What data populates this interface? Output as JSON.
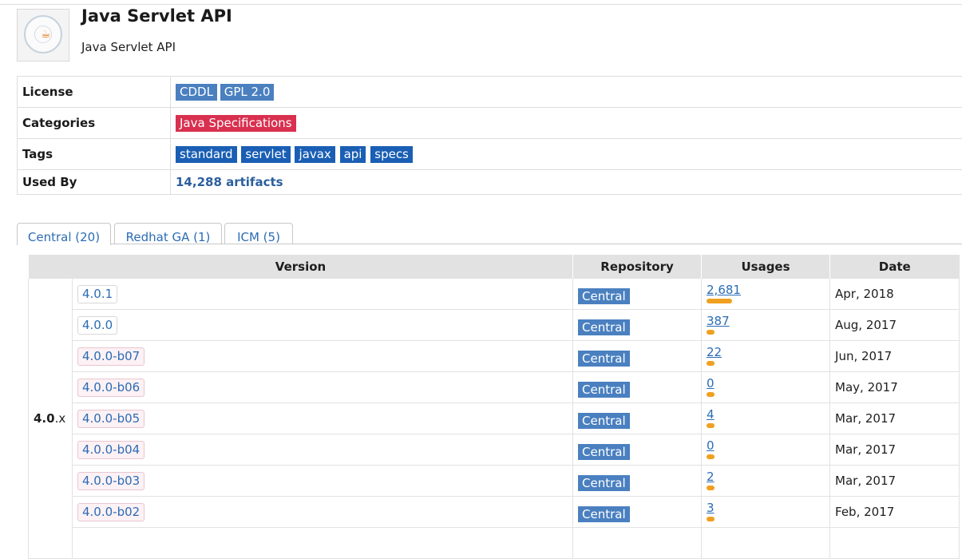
{
  "artifact": {
    "title": "Java Servlet API",
    "description": "Java Servlet API",
    "logo_alt": "Java Community Process seal"
  },
  "info": {
    "license": {
      "key": "License",
      "labels": [
        "CDDL",
        "GPL 2.0"
      ]
    },
    "categories": {
      "key": "Categories",
      "labels": [
        "Java Specifications"
      ]
    },
    "tags": {
      "key": "Tags",
      "labels": [
        "standard",
        "servlet",
        "javax",
        "api",
        "specs"
      ]
    },
    "used_by": {
      "key": "Used By",
      "value": "14,288 artifacts"
    }
  },
  "tabs": [
    {
      "label": "Central (20)",
      "active": true
    },
    {
      "label": "Redhat GA (1)",
      "active": false
    },
    {
      "label": "ICM (5)",
      "active": false
    }
  ],
  "versions_table": {
    "headers": {
      "version": "Version",
      "repository": "Repository",
      "usages": "Usages",
      "date": "Date"
    },
    "group": {
      "major": "4.0",
      "suffix": ".x"
    },
    "rows": [
      {
        "version": "4.0.1",
        "beta": false,
        "repository": "Central",
        "usages": "2,681",
        "usage_fraction": 1.0,
        "date": "Apr, 2018"
      },
      {
        "version": "4.0.0",
        "beta": false,
        "repository": "Central",
        "usages": "387",
        "usage_fraction": 0.145,
        "date": "Aug, 2017"
      },
      {
        "version": "4.0.0-b07",
        "beta": true,
        "repository": "Central",
        "usages": "22",
        "usage_fraction": 0.01,
        "date": "Jun, 2017"
      },
      {
        "version": "4.0.0-b06",
        "beta": true,
        "repository": "Central",
        "usages": "0",
        "usage_fraction": 0.0,
        "date": "May, 2017"
      },
      {
        "version": "4.0.0-b05",
        "beta": true,
        "repository": "Central",
        "usages": "4",
        "usage_fraction": 0.002,
        "date": "Mar, 2017"
      },
      {
        "version": "4.0.0-b04",
        "beta": true,
        "repository": "Central",
        "usages": "0",
        "usage_fraction": 0.0,
        "date": "Mar, 2017"
      },
      {
        "version": "4.0.0-b03",
        "beta": true,
        "repository": "Central",
        "usages": "2",
        "usage_fraction": 0.001,
        "date": "Mar, 2017"
      },
      {
        "version": "4.0.0-b02",
        "beta": true,
        "repository": "Central",
        "usages": "3",
        "usage_fraction": 0.001,
        "date": "Feb, 2017"
      }
    ]
  },
  "colors": {
    "license_label": "#4a80c0",
    "category_label": "#d9304f",
    "tag_label": "#1a5fb4",
    "usage_bar": "#f0a020",
    "link": "#2b6cb5"
  }
}
